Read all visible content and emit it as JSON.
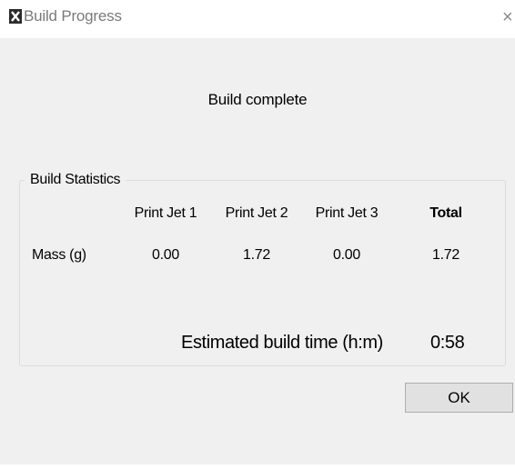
{
  "window": {
    "title": "Build Progress",
    "close_glyph": "×",
    "app_icon": "x-app-icon"
  },
  "status_text": "Build complete",
  "statistics": {
    "group_label": "Build Statistics",
    "columns": [
      "Print Jet 1",
      "Print Jet 2",
      "Print Jet 3",
      "Total"
    ],
    "rows": [
      {
        "label": "Mass (g)",
        "values": [
          "0.00",
          "1.72",
          "0.00",
          "1.72"
        ]
      }
    ]
  },
  "estimate": {
    "label": "Estimated build time (h:m)",
    "value": "0:58"
  },
  "buttons": {
    "ok_label": "OK"
  }
}
